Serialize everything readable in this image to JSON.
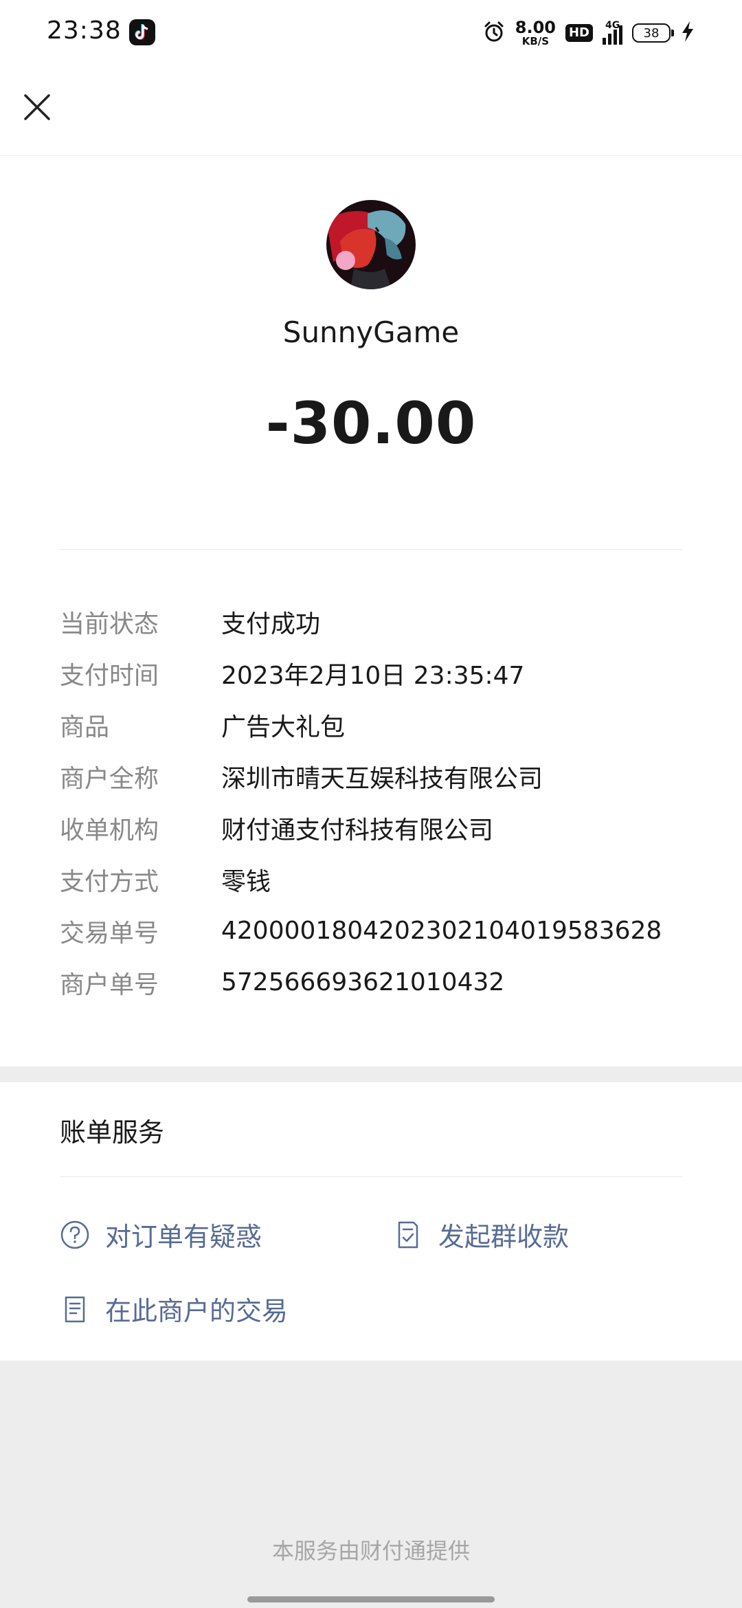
{
  "status_bar": {
    "time": "23:38",
    "speed_value": "8.00",
    "speed_unit": "KB/S",
    "hd": "HD",
    "network": "4G",
    "battery": "38"
  },
  "payment": {
    "merchant_name": "SunnyGame",
    "amount": "-30.00"
  },
  "details": [
    {
      "label": "当前状态",
      "value": "支付成功"
    },
    {
      "label": "支付时间",
      "value": "2023年2月10日 23:35:47"
    },
    {
      "label": "商品",
      "value": "广告大礼包"
    },
    {
      "label": "商户全称",
      "value": "深圳市晴天互娱科技有限公司"
    },
    {
      "label": "收单机构",
      "value": "财付通支付科技有限公司"
    },
    {
      "label": "支付方式",
      "value": "零钱"
    },
    {
      "label": "交易单号",
      "value": "4200001804202302104019583628"
    },
    {
      "label": "商户单号",
      "value": "572566693621010432"
    }
  ],
  "services": {
    "title": "账单服务",
    "question_label": "对订单有疑惑",
    "group_label": "发起群收款",
    "merchant_label": "在此商户的交易"
  },
  "footer": {
    "text": "本服务由财付通提供"
  },
  "colors": {
    "link": "#576b95",
    "label_gray": "#888888",
    "background": "#ededed"
  }
}
